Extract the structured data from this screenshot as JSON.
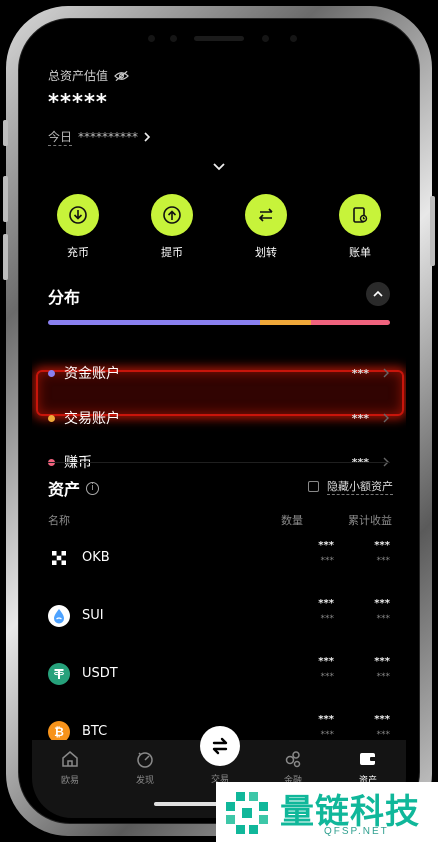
{
  "header": {
    "total_label": "总资产估值",
    "total_value": "*****",
    "today_label": "今日",
    "today_value": "**********"
  },
  "actions": [
    {
      "label": "充币",
      "icon": "deposit-icon"
    },
    {
      "label": "提币",
      "icon": "withdraw-icon"
    },
    {
      "label": "划转",
      "icon": "transfer-icon"
    },
    {
      "label": "账单",
      "icon": "bill-icon"
    }
  ],
  "distribution": {
    "title": "分布",
    "bar": [
      {
        "color": "#8a80f0",
        "share": 0.62
      },
      {
        "color": "#f0a93a",
        "share": 0.15
      },
      {
        "color": "#f0637e",
        "share": 0.23
      }
    ],
    "accounts": [
      {
        "name": "资金账户",
        "value": "***",
        "color": "#8a80f0"
      },
      {
        "name": "交易账户",
        "value": "***",
        "color": "#f0a93a"
      },
      {
        "name": "赚币",
        "value": "***",
        "color": "#f0637e"
      }
    ]
  },
  "assets": {
    "title": "资产",
    "hide_small_label": "隐藏小额资产",
    "columns": {
      "name": "名称",
      "amount": "数量",
      "profit": "累计收益"
    },
    "rows": [
      {
        "symbol": "OKB",
        "amount": "***",
        "amount_sub": "***",
        "profit": "***",
        "profit_sub": "***",
        "icon": "okb-icon"
      },
      {
        "symbol": "SUI",
        "amount": "***",
        "amount_sub": "***",
        "profit": "***",
        "profit_sub": "***",
        "icon": "sui-icon"
      },
      {
        "symbol": "USDT",
        "amount": "***",
        "amount_sub": "***",
        "profit": "***",
        "profit_sub": "***",
        "icon": "usdt-icon"
      },
      {
        "symbol": "BTC",
        "amount": "***",
        "amount_sub": "***",
        "profit": "***",
        "profit_sub": "***",
        "icon": "btc-icon"
      }
    ]
  },
  "tabbar": {
    "tabs": [
      {
        "label": "欧易",
        "icon": "home-icon"
      },
      {
        "label": "发现",
        "icon": "discover-icon"
      },
      {
        "label": "交易",
        "icon": "trade-icon"
      },
      {
        "label": "金融",
        "icon": "finance-icon"
      },
      {
        "label": "资产",
        "icon": "wallet-icon"
      }
    ]
  },
  "watermark": {
    "name": "量链科技",
    "domain": "QFSP.NET"
  },
  "colors": {
    "accent": "#c7f33a",
    "highlight": "#c8150b",
    "watermark": "#10b79a"
  }
}
